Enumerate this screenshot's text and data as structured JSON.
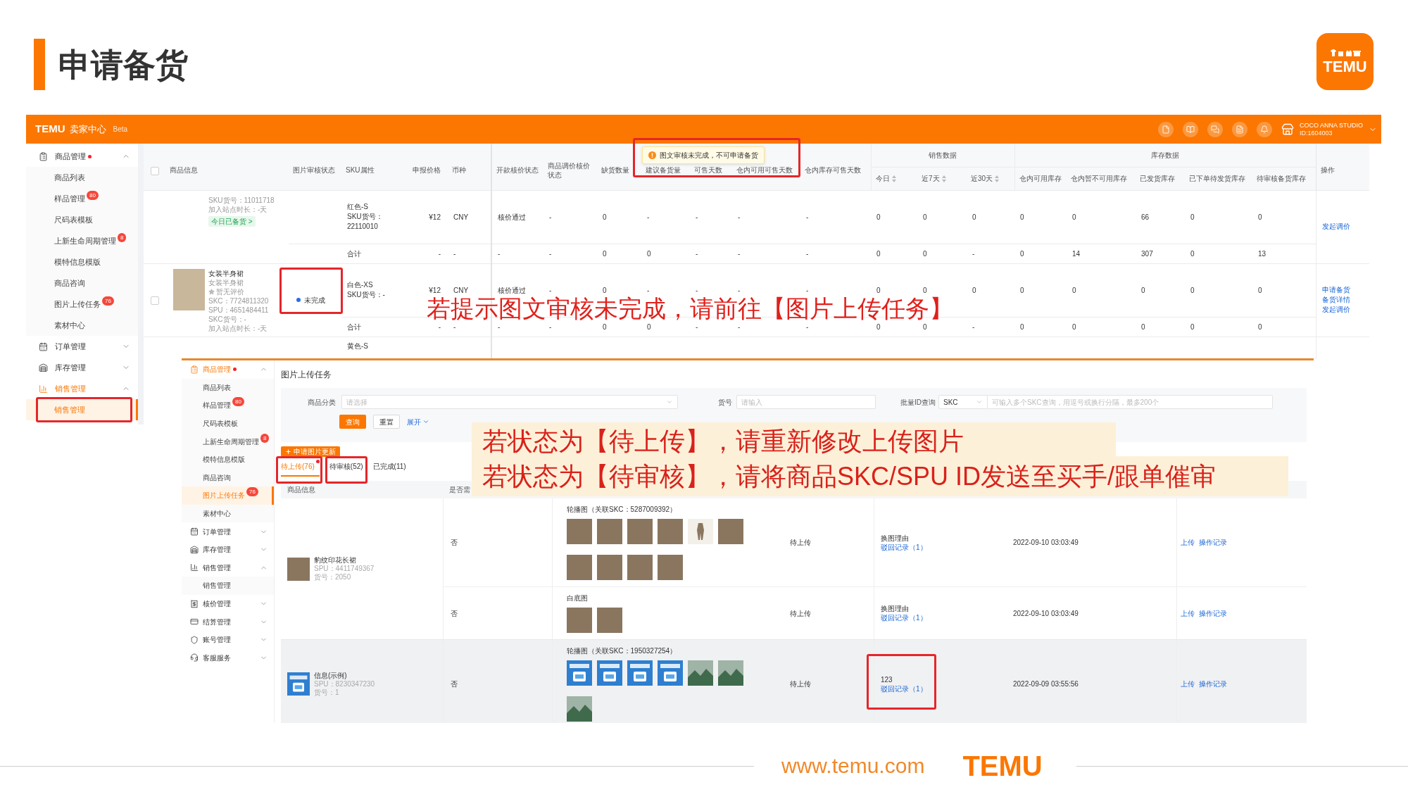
{
  "slide": {
    "title": "申请备货",
    "logo": "TEMU"
  },
  "seller_center": {
    "header": {
      "brand": "TEMU",
      "name": "卖家中心",
      "tag": "Beta",
      "store": "COCO ANNA STUDIO",
      "store_id": "ID:1604003"
    },
    "sidebar": [
      {
        "label": "商品管理",
        "dot": true,
        "expanded": true,
        "children": [
          {
            "label": "商品列表",
            "selected": false
          },
          {
            "label": "样品管理",
            "badge": "80",
            "selected": false
          },
          {
            "label": "尺码表模板",
            "selected": false
          },
          {
            "label": "上新生命周期管理",
            "badge": "8",
            "selected": false
          },
          {
            "label": "模特信息模版",
            "selected": false
          },
          {
            "label": "商品咨询",
            "selected": false
          },
          {
            "label": "图片上传任务",
            "badge": "76",
            "selected": false
          },
          {
            "label": "素材中心",
            "selected": false
          }
        ]
      },
      {
        "label": "订单管理",
        "dot": false,
        "expanded": false
      },
      {
        "label": "库存管理",
        "dot": false,
        "expanded": false
      },
      {
        "label": "销售管理",
        "dot": false,
        "expanded": true,
        "children": [
          {
            "label": "销售管理",
            "selected": true
          }
        ]
      }
    ],
    "table": {
      "select_all": {
        "checked": false
      },
      "columns": [
        {
          "label": "商品信息"
        },
        {
          "label": "图片审核状态"
        },
        {
          "label": "SKU属性"
        },
        {
          "label": "申报价格"
        },
        {
          "label": "币种"
        },
        {
          "label": "开款核价状态"
        },
        {
          "label": "商品调价核价状态"
        },
        {
          "label": "缺货数量"
        },
        {
          "label": "建议备货量"
        },
        {
          "label": "可售天数"
        },
        {
          "label": "仓内可用可售天数"
        },
        {
          "label": "仓内库存可售天数"
        },
        {
          "label": "销售数据",
          "colspan": 3,
          "children": [
            {
              "label": "今日",
              "sortable": true
            },
            {
              "label": "近7天",
              "sortable": true
            },
            {
              "label": "近30天",
              "sortable": true
            }
          ]
        },
        {
          "label": "库存数据",
          "colspan": 5,
          "children": [
            {
              "label": "仓内可用库存"
            },
            {
              "label": "仓内暂不可用库存"
            },
            {
              "label": "已发货库存"
            },
            {
              "label": "已下单待发货库存"
            },
            {
              "label": "待审核备货库存"
            }
          ]
        },
        {
          "label": "操作"
        }
      ],
      "rows": [
        {
          "kind": "item",
          "cells": [
            {
              "rowspan": 2,
              "lines": [
                "SKU货号：11011718",
                "加入站点时长：-天"
              ],
              "tag": "今日已备货 >"
            },
            "",
            [
              "红色-S",
              "SKU货号：",
              "22110010"
            ],
            "¥12",
            "CNY",
            "核价通过",
            "-",
            "0",
            "-",
            "-",
            "-",
            "-",
            "0",
            "0",
            "0",
            "0",
            "0",
            "66",
            "0",
            "0",
            {
              "rowspan": 2,
              "links": [
                "发起调价"
              ]
            }
          ]
        },
        {
          "kind": "subtotal",
          "cells": [
            "",
            "合计",
            "-",
            "-",
            "-",
            "-",
            "0",
            "0",
            "-",
            "-",
            "-",
            "0",
            "0",
            "-",
            "0",
            "14",
            "307",
            "0",
            "13"
          ]
        },
        {
          "kind": "item",
          "checked": false,
          "cells": [
            {
              "rowspan": 2,
              "image": true,
              "title": "女装半身裙",
              "subtitle": "女装半身裙",
              "rating": "暂无评价",
              "lines": [
                "SKC：7724811320",
                "SPU：4651484411",
                "SKC货号：-",
                "加入站点时长：-天"
              ]
            },
            {
              "rowspan": 2,
              "label": "未完成",
              "color": "#2b6de5"
            },
            [
              "白色-XS",
              "SKU货号：-"
            ],
            "¥12",
            "CNY",
            "核价通过",
            "-",
            "0",
            "-",
            "-",
            "-",
            "-",
            "0",
            "0",
            "0",
            "0",
            "0",
            "0",
            "0",
            "0",
            {
              "rowspan": 2,
              "links": [
                "申请备货",
                "备货详情",
                "发起调价"
              ]
            }
          ]
        },
        {
          "kind": "subtotal",
          "cells": [
            "合计",
            "-",
            "-",
            "-",
            "-",
            "0",
            "0",
            "-",
            "-",
            "-",
            "0",
            "0",
            "-",
            "0",
            "0",
            "0",
            "0",
            "0"
          ]
        },
        {
          "kind": "item",
          "cells": [
            "",
            "",
            [
              "黄色-S"
            ]
          ]
        }
      ]
    },
    "tooltip": "图文审核未完成，不可申请备货"
  },
  "notes": {
    "upload_hint": "若提示图文审核未完成，请前往【图片上传任务】",
    "status_hints": [
      "若状态为【待上传】，请重新修改上传图片",
      "若状态为【待审核】，请将商品SKC/SPU ID发送至买手/跟单催审"
    ]
  },
  "upload_page": {
    "sidebar": [
      {
        "label": "商品管理",
        "dot": true,
        "expanded": true,
        "children": [
          {
            "label": "商品列表",
            "selected": false
          },
          {
            "label": "样品管理",
            "badge": "80",
            "selected": false
          },
          {
            "label": "尺码表模板",
            "selected": false
          },
          {
            "label": "上新生命周期管理",
            "badge": "8",
            "selected": false
          },
          {
            "label": "模特信息模版",
            "selected": false
          },
          {
            "label": "商品咨询",
            "selected": false
          },
          {
            "label": "图片上传任务",
            "badge": "76",
            "selected": true
          },
          {
            "label": "素材中心",
            "selected": false
          }
        ]
      },
      {
        "label": "订单管理",
        "dot": false,
        "expanded": false
      },
      {
        "label": "库存管理",
        "dot": false,
        "expanded": false
      },
      {
        "label": "销售管理",
        "dot": false,
        "expanded": true,
        "children": [
          {
            "label": "销售管理",
            "selected": false
          }
        ]
      },
      {
        "label": "核价管理",
        "dot": false,
        "expanded": false
      },
      {
        "label": "结算管理",
        "dot": false,
        "expanded": false
      },
      {
        "label": "账号管理",
        "dot": false,
        "expanded": false
      },
      {
        "label": "客服服务",
        "dot": false,
        "expanded": false
      }
    ],
    "title": "图片上传任务",
    "filters": [
      {
        "kind": "select",
        "label": "商品分类",
        "placeholder": "请选择"
      },
      {
        "kind": "input",
        "label": "货号",
        "placeholder": "请输入"
      },
      {
        "kind": "id_query",
        "label": "批量ID查询",
        "option": "SKC",
        "placeholder": "可输入多个SKC查询，用逗号或换行分隔，最多200个"
      }
    ],
    "actions": [
      {
        "kind": "primary",
        "label": "查询"
      },
      {
        "kind": "default",
        "label": "重置"
      },
      {
        "kind": "link",
        "label": "展开"
      }
    ],
    "apply_button": "申请图片更新",
    "tabs": [
      {
        "label": "待上传(76)",
        "selected": true,
        "dot": true
      },
      {
        "label": "待审核(52)",
        "selected": false,
        "dot": false
      },
      {
        "label": "已完成(11)",
        "selected": false,
        "dot": false
      }
    ],
    "table": {
      "columns": [
        "商品信息",
        "是否需"
      ],
      "groups": [
        {
          "product": {
            "thumb": {
              "kind": "photo"
            },
            "title": "豹纹印花长裙",
            "lines": [
              "SPU：4411749367",
              "货号：2050"
            ]
          },
          "highlighted": false,
          "entries": [
            {
              "need": "否",
              "gallery": {
                "label": "轮播图（关联SKC：5287009392）",
                "thumbs": [
                  {
                    "kind": "photo"
                  },
                  {
                    "kind": "photo"
                  },
                  {
                    "kind": "photo"
                  },
                  {
                    "kind": "photo"
                  },
                  {
                    "kind": "cutout"
                  },
                  {
                    "kind": "photo"
                  },
                  {
                    "kind": "photo"
                  },
                  {
                    "kind": "photo"
                  },
                  {
                    "kind": "photo"
                  },
                  {
                    "kind": "photo"
                  }
                ]
              },
              "status": "待上传",
              "remark": "换图理由",
              "record": "驳回记录（1）",
              "time": "2022-09-10 03:03:49",
              "links": [
                "上传",
                "操作记录"
              ]
            },
            {
              "need": "否",
              "gallery": {
                "label": "白底图",
                "thumbs": [
                  {
                    "kind": "photo"
                  },
                  {
                    "kind": "photo"
                  }
                ]
              },
              "status": "待上传",
              "remark": "换图理由",
              "record": "驳回记录（1）",
              "time": "2022-09-10 03:03:49",
              "links": [
                "上传",
                "操作记录"
              ]
            }
          ]
        },
        {
          "product": {
            "thumb": {
              "kind": "banner"
            },
            "title": "信息(示例)",
            "lines": [
              "SPU：8230347230",
              "货号：1"
            ]
          },
          "highlighted": true,
          "entries": [
            {
              "need": "否",
              "gallery": {
                "label": "轮播图（关联SKC：1950327254）",
                "thumbs": [
                  {
                    "kind": "banner"
                  },
                  {
                    "kind": "banner"
                  },
                  {
                    "kind": "banner"
                  },
                  {
                    "kind": "banner"
                  },
                  {
                    "kind": "scene"
                  },
                  {
                    "kind": "scene"
                  },
                  {
                    "kind": "scene"
                  }
                ]
              },
              "status": "待上传",
              "remark": "123",
              "record": "驳回记录（1）",
              "time": "2022-09-09 03:55:56",
              "links": [
                "上传",
                "操作记录"
              ]
            }
          ]
        }
      ]
    }
  },
  "footer": {
    "url": "www.temu.com",
    "logo": "TEMU"
  }
}
